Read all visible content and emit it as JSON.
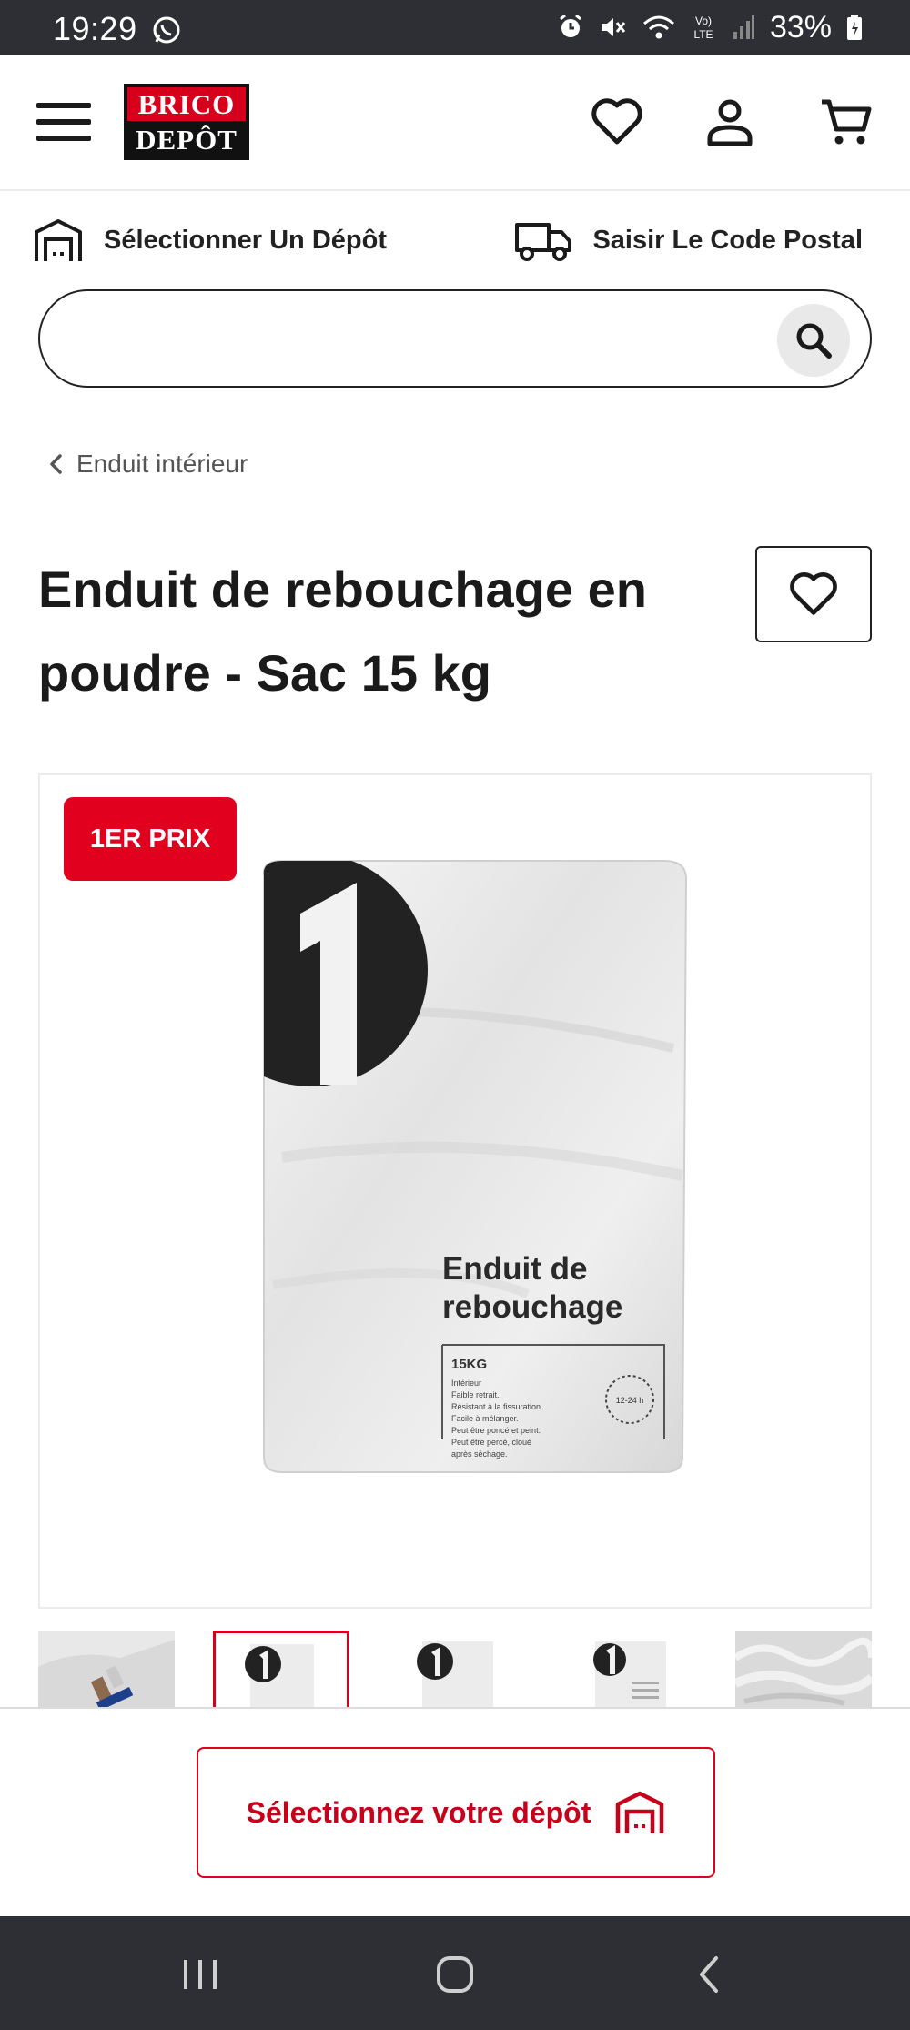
{
  "status_bar": {
    "time": "19:29",
    "battery": "33%",
    "icons": [
      "whatsapp-icon",
      "alarm-icon",
      "mute-icon",
      "wifi-icon",
      "volte-icon",
      "signal-icon",
      "battery-icon"
    ]
  },
  "header": {
    "logo_top": "BRICO",
    "logo_bottom": "DEPÔT",
    "icons": [
      "menu-icon",
      "heart-icon",
      "user-icon",
      "cart-icon"
    ]
  },
  "store_row": {
    "store_label": "Sélectionner Un Dépôt",
    "postal_label": "Saisir Le Code Postal"
  },
  "search": {
    "placeholder": "",
    "value": ""
  },
  "breadcrumb": {
    "label": "Enduit intérieur"
  },
  "product": {
    "title": "Enduit de rebouchage en poudre - Sac 15 kg",
    "badge": "1ER PRIX",
    "bag_label_line1": "Enduit de",
    "bag_label_line2": "rebouchage",
    "bag_weight": "15KG",
    "bag_details": [
      "Intérieur",
      "Faible retrait.",
      "Résistant à la fissuration.",
      "Facile à mélanger.",
      "Peut être poncé et peint.",
      "Peut être percé, cloué",
      "après séchage."
    ],
    "bag_time": "12-24 h"
  },
  "thumbnails": [
    "thumb-application",
    "thumb-bag-front",
    "thumb-bag-front-2",
    "thumb-bag-back",
    "thumb-texture"
  ],
  "sticky": {
    "select_depot_label": "Sélectionnez votre dépôt"
  },
  "colors": {
    "brand_red": "#e1001d",
    "status_bar": "#2d2f34",
    "text": "#1a1a1a"
  }
}
